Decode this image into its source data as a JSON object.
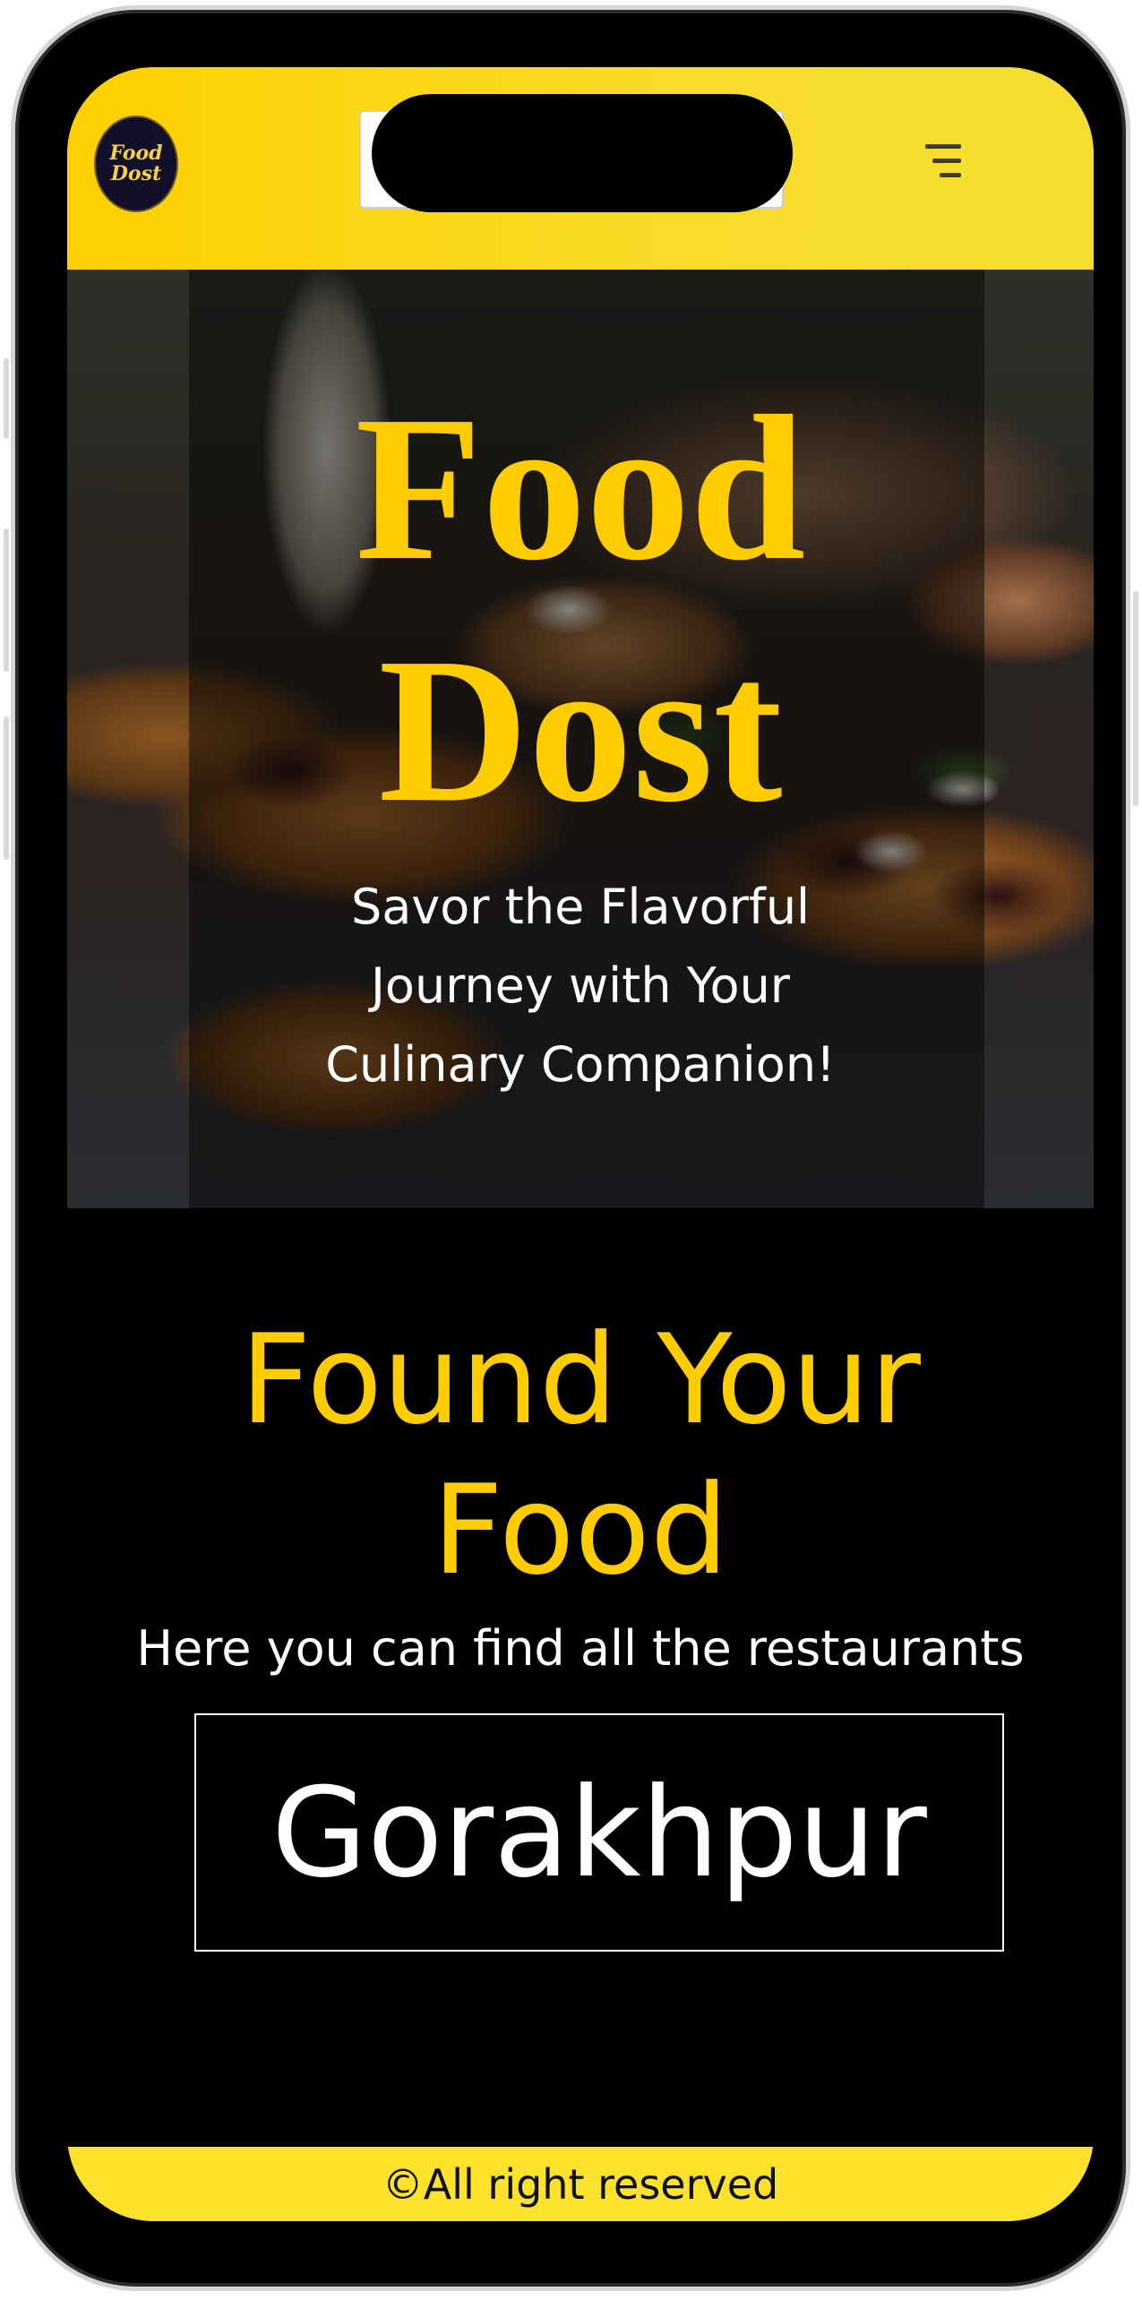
{
  "header": {
    "logo_line1": "Food",
    "logo_line2": "Dost",
    "search_value": "",
    "menu_icon": "hamburger-menu-icon"
  },
  "hero": {
    "title_line1": "Food",
    "title_line2": "Dost",
    "tagline_line1": "Savor the Flavorful",
    "tagline_line2": "Journey with Your",
    "tagline_line3": "Culinary Companion!"
  },
  "found": {
    "title_line1": "Found Your",
    "title_line2": "Food",
    "subtitle": "Here you can find all the restaurants",
    "city": "Gorakhpur"
  },
  "footer": {
    "text": "©All right reserved"
  },
  "colors": {
    "accent_yellow": "#ffcc00",
    "header_yellow": "#f8dc2a",
    "background": "#000000",
    "text_white": "#ffffff"
  }
}
